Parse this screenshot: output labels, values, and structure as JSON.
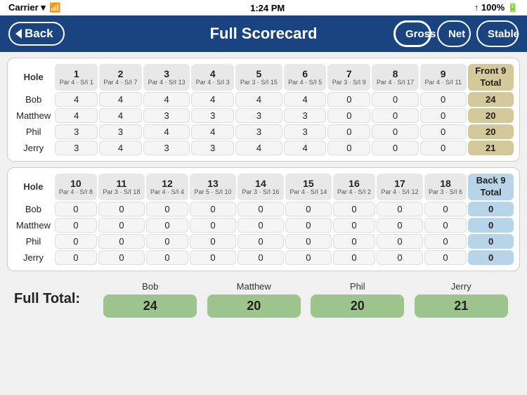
{
  "statusBar": {
    "carrier": "Carrier",
    "time": "1:24 PM",
    "signal": "wifi",
    "battery": "100%"
  },
  "header": {
    "backLabel": "Back",
    "title": "Full Scorecard",
    "buttons": [
      "Gross",
      "Net",
      "Stable"
    ],
    "activeButton": "Gross"
  },
  "front9": {
    "sectionTitle": "Front 9",
    "totalLabel": "Front 9\nTotal",
    "holes": [
      {
        "num": "1",
        "par": "4",
        "si": "1"
      },
      {
        "num": "2",
        "par": "4",
        "si": "7"
      },
      {
        "num": "3",
        "par": "4",
        "si": "13"
      },
      {
        "num": "4",
        "par": "4",
        "si": "3"
      },
      {
        "num": "5",
        "par": "3",
        "si": "15"
      },
      {
        "num": "6",
        "par": "4",
        "si": "5"
      },
      {
        "num": "7",
        "par": "3",
        "si": "9"
      },
      {
        "num": "8",
        "par": "4",
        "si": "17"
      },
      {
        "num": "9",
        "par": "4",
        "si": "11"
      }
    ],
    "players": [
      {
        "name": "Bob",
        "scores": [
          4,
          4,
          4,
          4,
          4,
          4,
          0,
          0,
          0
        ],
        "total": 24
      },
      {
        "name": "Matthew",
        "scores": [
          4,
          4,
          3,
          3,
          3,
          3,
          0,
          0,
          0
        ],
        "total": 20
      },
      {
        "name": "Phil",
        "scores": [
          3,
          3,
          4,
          4,
          3,
          3,
          0,
          0,
          0
        ],
        "total": 20
      },
      {
        "name": "Jerry",
        "scores": [
          3,
          4,
          3,
          3,
          4,
          4,
          0,
          0,
          0
        ],
        "total": 21
      }
    ]
  },
  "back9": {
    "sectionTitle": "Back 9",
    "totalLabel": "Back 9\nTotal",
    "holes": [
      {
        "num": "10",
        "par": "4",
        "si": "8"
      },
      {
        "num": "11",
        "par": "3",
        "si": "18"
      },
      {
        "num": "12",
        "par": "4",
        "si": "4"
      },
      {
        "num": "13",
        "par": "5",
        "si": "10"
      },
      {
        "num": "14",
        "par": "3",
        "si": "16"
      },
      {
        "num": "15",
        "par": "4",
        "si": "14"
      },
      {
        "num": "16",
        "par": "4",
        "si": "2"
      },
      {
        "num": "17",
        "par": "4",
        "si": "12"
      },
      {
        "num": "18",
        "par": "3",
        "si": "6"
      }
    ],
    "players": [
      {
        "name": "Bob",
        "scores": [
          0,
          0,
          0,
          0,
          0,
          0,
          0,
          0,
          0
        ],
        "total": 0
      },
      {
        "name": "Matthew",
        "scores": [
          0,
          0,
          0,
          0,
          0,
          0,
          0,
          0,
          0
        ],
        "total": 0
      },
      {
        "name": "Phil",
        "scores": [
          0,
          0,
          0,
          0,
          0,
          0,
          0,
          0,
          0
        ],
        "total": 0
      },
      {
        "name": "Jerry",
        "scores": [
          0,
          0,
          0,
          0,
          0,
          0,
          0,
          0,
          0
        ],
        "total": 0
      }
    ]
  },
  "fullTotal": {
    "label": "Full Total:",
    "players": [
      {
        "name": "Bob",
        "total": 24
      },
      {
        "name": "Matthew",
        "total": 20
      },
      {
        "name": "Phil",
        "total": 20
      },
      {
        "name": "Jerry",
        "total": 21
      }
    ]
  }
}
